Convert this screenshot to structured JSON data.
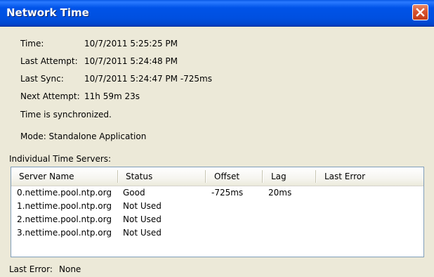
{
  "window": {
    "title": "Network Time"
  },
  "info": {
    "time_label": "Time:",
    "time_value": "10/7/2011 5:25:25 PM",
    "last_attempt_label": "Last Attempt:",
    "last_attempt_value": "10/7/2011 5:24:48 PM",
    "last_sync_label": "Last Sync:",
    "last_sync_value": "10/7/2011 5:24:47 PM -725ms",
    "next_attempt_label": "Next Attempt:",
    "next_attempt_value": "11h 59m 23s",
    "sync_status": "Time is synchronized.",
    "mode": "Mode: Standalone Application"
  },
  "servers": {
    "section_label": "Individual Time Servers:",
    "columns": [
      "Server Name",
      "Status",
      "Offset",
      "Lag",
      "Last Error"
    ],
    "rows": [
      {
        "server": "0.nettime.pool.ntp.org",
        "status": "Good",
        "offset": "-725ms",
        "lag": "20ms",
        "last_error": ""
      },
      {
        "server": "1.nettime.pool.ntp.org",
        "status": "Not Used",
        "offset": "",
        "lag": "",
        "last_error": ""
      },
      {
        "server": "2.nettime.pool.ntp.org",
        "status": "Not Used",
        "offset": "",
        "lag": "",
        "last_error": ""
      },
      {
        "server": "3.nettime.pool.ntp.org",
        "status": "Not Used",
        "offset": "",
        "lag": "",
        "last_error": ""
      }
    ]
  },
  "footer": {
    "last_error_label": "Last Error:",
    "last_error_value": "None"
  },
  "colors": {
    "titlebar": "#0053e8",
    "close_button": "#d8532f",
    "dialog_background": "#ece9d8",
    "list_border": "#7f9db9"
  },
  "icons": {
    "close": "close-x-icon"
  }
}
